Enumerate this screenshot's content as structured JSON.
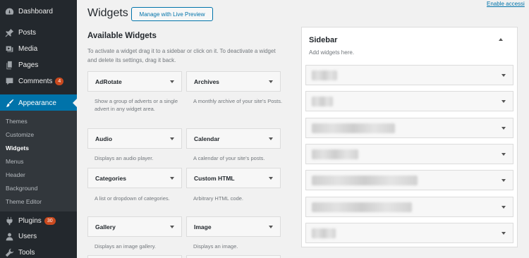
{
  "menu": {
    "dashboard": "Dashboard",
    "posts": "Posts",
    "media": "Media",
    "pages": "Pages",
    "comments": "Comments",
    "comments_badge": "4",
    "appearance": "Appearance",
    "plugins": "Plugins",
    "plugins_badge": "30",
    "users": "Users",
    "tools": "Tools"
  },
  "submenu": {
    "themes": "Themes",
    "customize": "Customize",
    "widgets": "Widgets",
    "menus": "Menus",
    "header": "Header",
    "background": "Background",
    "theme_editor": "Theme Editor"
  },
  "header": {
    "title": "Widgets",
    "live_preview_label": "Manage with Live Preview",
    "enable_accessibility": "Enable accessi"
  },
  "available": {
    "title": "Available Widgets",
    "description": "To activate a widget drag it to a sidebar or click on it. To deactivate a widget and delete its settings, drag it back."
  },
  "widgets": [
    {
      "name": "AdRotate",
      "desc": "Show a group of adverts or a single advert in any widget area."
    },
    {
      "name": "Archives",
      "desc": "A monthly archive of your site's Posts."
    },
    {
      "name": "Audio",
      "desc": "Displays an audio player."
    },
    {
      "name": "Calendar",
      "desc": "A calendar of your site's posts."
    },
    {
      "name": "Categories",
      "desc": "A list or dropdown of categories."
    },
    {
      "name": "Custom HTML",
      "desc": "Arbitrary HTML code."
    },
    {
      "name": "Gallery",
      "desc": "Displays an image gallery."
    },
    {
      "name": "Image",
      "desc": "Displays an image."
    }
  ],
  "sidebar": {
    "title": "Sidebar",
    "description": "Add widgets here."
  },
  "colors": {
    "accent": "#0073aa",
    "admin_bar": "#23282d",
    "badge": "#ca4a1f"
  }
}
